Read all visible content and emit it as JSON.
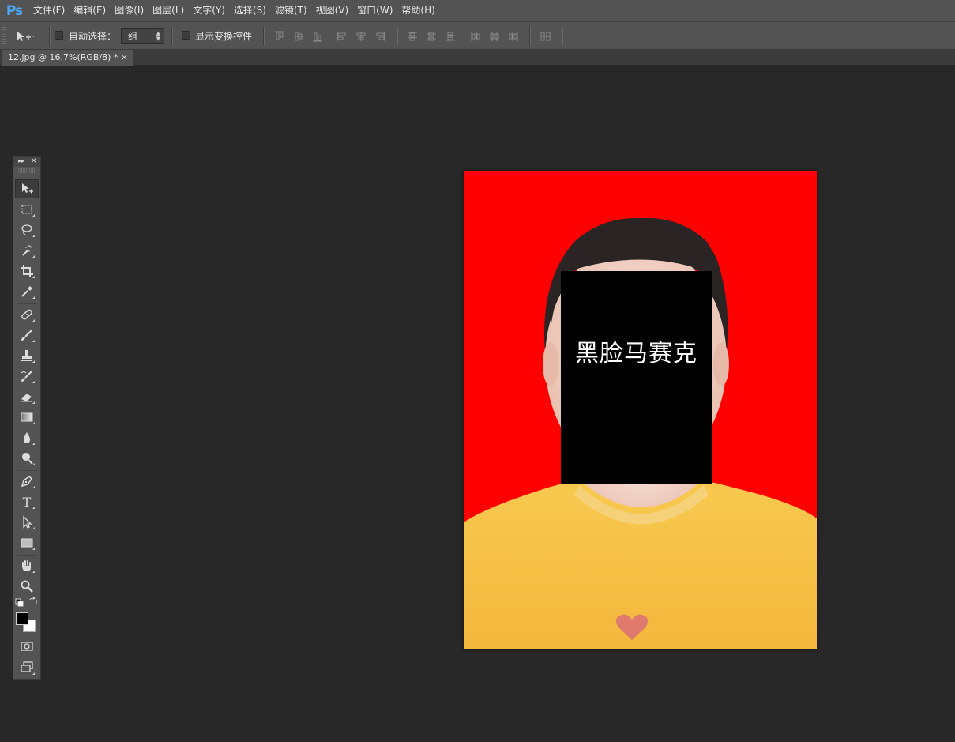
{
  "app": {
    "logo": "Ps",
    "menu": [
      "文件(F)",
      "编辑(E)",
      "图像(I)",
      "图层(L)",
      "文字(Y)",
      "选择(S)",
      "滤镜(T)",
      "视图(V)",
      "窗口(W)",
      "帮助(H)"
    ]
  },
  "options": {
    "tool_icon": "move-tool-icon",
    "auto_select_label": "自动选择：",
    "auto_select_checked": false,
    "auto_select_target": "组",
    "show_transform_label": "显示变换控件",
    "show_transform_checked": false
  },
  "document": {
    "tab_label": "12.jpg @ 16.7%(RGB/8) *",
    "tab_close": "×",
    "overlay_text": "黑脸马赛克"
  },
  "tools_panel": {
    "collapse_glyph": "▸▸",
    "close_glyph": "×",
    "tools": [
      "move-tool",
      "rectangular-marquee-tool",
      "lasso-tool",
      "magic-wand-tool",
      "crop-tool",
      "eyedropper-tool",
      "healing-brush-tool",
      "brush-tool",
      "clone-stamp-tool",
      "history-brush-tool",
      "eraser-tool",
      "gradient-tool",
      "blur-tool",
      "dodge-tool",
      "pen-tool",
      "type-tool",
      "path-selection-tool",
      "rectangle-tool",
      "hand-tool",
      "zoom-tool"
    ],
    "foreground_color": "#000000",
    "background_color": "#ffffff"
  },
  "colors": {
    "canvas_background": "#ff0000",
    "shirt": "#f6c24a",
    "workspace": "#282828"
  }
}
